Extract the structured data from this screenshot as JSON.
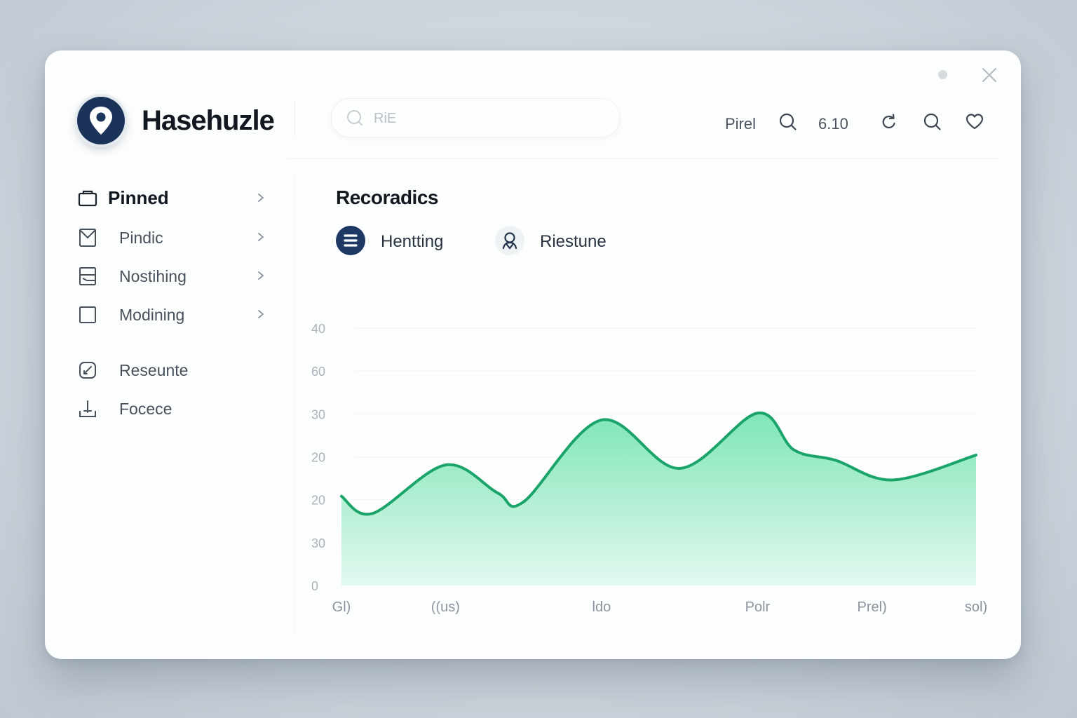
{
  "app": {
    "brand": "Hasehuzle"
  },
  "search": {
    "value": "",
    "placeholder": "RiE"
  },
  "toolbar": {
    "item1_label": "Pirel",
    "item2_label": "6.10"
  },
  "sidebar": {
    "items": [
      {
        "label": "Pinned",
        "active": true,
        "has_chevron": true
      },
      {
        "label": "Pindic",
        "has_chevron": true
      },
      {
        "label": "Nostihing",
        "has_chevron": true
      },
      {
        "label": "Modining",
        "has_chevron": true
      },
      {
        "label": "Reseunte",
        "has_chevron": false
      },
      {
        "label": "Focece",
        "has_chevron": false
      }
    ]
  },
  "main": {
    "title": "Recoradics",
    "legend": [
      {
        "label": "Hentting",
        "icon": "list-icon",
        "color": "#1e3a64"
      },
      {
        "label": "Riestune",
        "icon": "user-icon",
        "color": "#e8edf2"
      }
    ]
  },
  "colors": {
    "line": "#1aa46a",
    "fill_top": "#7fe6b8",
    "fill_bottom": "#e3f8ef"
  },
  "chart_data": {
    "type": "area",
    "y_tick_labels": [
      "40",
      "60",
      "30",
      "20",
      "20",
      "30",
      "0"
    ],
    "x_tick_labels": [
      "Gl)",
      "((us)",
      "ldo",
      "Polr",
      "Prel)",
      "sol)"
    ],
    "points": [
      {
        "x": 0.0,
        "y": 20.8
      },
      {
        "x": 0.3,
        "y": 16.8
      },
      {
        "x": 1.0,
        "y": 28.1
      },
      {
        "x": 1.5,
        "y": 21.6
      },
      {
        "x": 1.75,
        "y": 19.5
      },
      {
        "x": 2.5,
        "y": 38.6
      },
      {
        "x": 3.25,
        "y": 27.3
      },
      {
        "x": 4.0,
        "y": 40.2
      },
      {
        "x": 4.35,
        "y": 31.6
      },
      {
        "x": 4.75,
        "y": 29.2
      },
      {
        "x": 5.3,
        "y": 24.6
      },
      {
        "x": 6.1,
        "y": 30.4
      }
    ],
    "x_range": [
      0,
      6.1
    ],
    "y_range": [
      0,
      60
    ],
    "grid": true,
    "legend": "none"
  }
}
